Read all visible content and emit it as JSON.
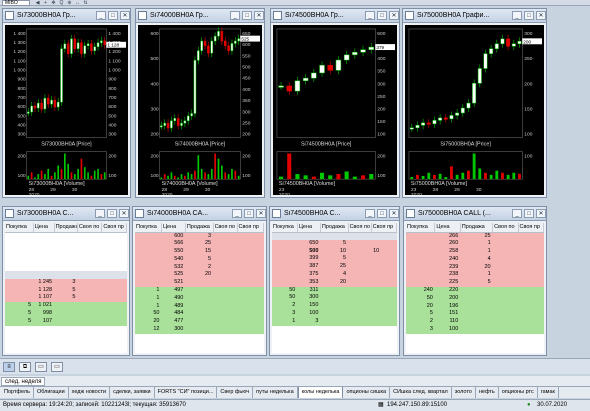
{
  "toolbar": {
    "combo": "MIBO",
    "buttons": [
      "◀",
      "+",
      "✥",
      "Q",
      "⊕",
      "↔",
      "⇅"
    ]
  },
  "charts": [
    {
      "title": "Si73000BH0A Гр...",
      "price_label": "Si73000BH0A [Price]",
      "volume_label": "Si73000BH0A [Volume]",
      "left_ticks": [
        "1 400",
        "1 300",
        "1 200",
        "1 100",
        "1 000",
        "900",
        "800",
        "700",
        "600",
        "500",
        "400",
        "300"
      ],
      "right_ticks": [
        "1 400",
        "1 300",
        "1 200",
        "1 100",
        "1 000",
        "900",
        "800",
        "700",
        "600",
        "500",
        "400",
        "300"
      ],
      "vol_ticks_left": [
        "200",
        "100"
      ],
      "vol_ticks_right": [
        "200",
        "100"
      ],
      "dates": [
        "28",
        "29",
        "30"
      ],
      "year": "2020",
      "marker": "1 128"
    },
    {
      "title": "Si74000BH0A Гр...",
      "price_label": "Si74000BH0A [Price]",
      "volume_label": "Si74000BH0A [Volume]",
      "left_ticks": [
        "600",
        "500",
        "400",
        "300",
        "200"
      ],
      "right_ticks": [
        "650",
        "600",
        "550",
        "500",
        "450",
        "400",
        "350",
        "300",
        "250",
        "200"
      ],
      "vol_ticks_left": [
        "200",
        "100"
      ],
      "vol_ticks_right": [
        "200",
        "100"
      ],
      "dates": [
        "28",
        "29",
        "30"
      ],
      "year": "2020",
      "marker": "525"
    },
    {
      "title": "Si74500BH0A Гр...",
      "price_label": "Si74500BH0A [Price]",
      "volume_label": "Si74500BH0A [Volume]",
      "left_ticks": [],
      "right_ticks": [
        "500",
        "450",
        "400",
        "350",
        "300",
        "250",
        "200",
        "150",
        "100"
      ],
      "vol_ticks_left": [],
      "vol_ticks_right": [
        "200",
        "100"
      ],
      "dates": [
        "23"
      ],
      "year": "2020",
      "marker": "379"
    },
    {
      "title": "Si75000BH0A Графи...",
      "price_label": "Si75000BH0A [Price]",
      "volume_label": "Si75000BH0A [Volume]",
      "left_ticks": [],
      "right_ticks": [
        "300",
        "250",
        "200",
        "150",
        "100"
      ],
      "vol_ticks_left": [],
      "vol_ticks_right": [
        "100"
      ],
      "dates": [
        "23",
        "28",
        "29",
        "30"
      ],
      "year": "2020",
      "marker": "200"
    }
  ],
  "tables": [
    {
      "title": "Si73000BH0A C...",
      "headers": [
        "Покупка",
        "Цена",
        "Продажа",
        "Своя по",
        "Своя пр"
      ],
      "rows": [
        {
          "side": "empty",
          "cells": [
            "",
            "",
            "",
            "",
            ""
          ]
        },
        {
          "side": "empty",
          "cells": [
            "",
            "",
            "",
            "",
            ""
          ]
        },
        {
          "side": "empty",
          "cells": [
            "",
            "",
            "",
            "",
            ""
          ]
        },
        {
          "side": "empty",
          "cells": [
            "",
            "",
            "",
            "",
            ""
          ]
        },
        {
          "side": "empty",
          "cells": [
            "",
            "",
            "",
            "",
            ""
          ]
        },
        {
          "side": "empty",
          "cells": [
            "",
            "",
            "",
            "",
            ""
          ]
        },
        {
          "side": "sell",
          "cells": [
            "",
            "1 245",
            "3",
            "",
            ""
          ]
        },
        {
          "side": "sell",
          "cells": [
            "",
            "1 128",
            "5",
            "",
            ""
          ]
        },
        {
          "side": "sell",
          "cells": [
            "",
            "1 107",
            "5",
            "",
            ""
          ]
        },
        {
          "side": "buy",
          "cells": [
            "5",
            "1 021",
            "",
            "",
            ""
          ]
        },
        {
          "side": "buy",
          "cells": [
            "5",
            "998",
            "",
            "",
            ""
          ]
        },
        {
          "side": "buy",
          "cells": [
            "5",
            "107",
            "",
            "",
            ""
          ]
        }
      ]
    },
    {
      "title": "Si74000BH0A CA...",
      "headers": [
        "Покупка",
        "Цена",
        "Продажа",
        "Своя по",
        "Своя пр"
      ],
      "rows": [
        {
          "side": "sell",
          "cells": [
            "",
            "600",
            "3",
            "",
            ""
          ]
        },
        {
          "side": "sell",
          "cells": [
            "",
            "566",
            "25",
            "",
            ""
          ]
        },
        {
          "side": "sell",
          "cells": [
            "",
            "550",
            "15",
            "",
            ""
          ]
        },
        {
          "side": "sell",
          "cells": [
            "",
            "540",
            "5",
            "",
            ""
          ]
        },
        {
          "side": "sell",
          "cells": [
            "",
            "532",
            "2",
            "",
            ""
          ]
        },
        {
          "side": "sell",
          "cells": [
            "",
            "525",
            "20",
            "",
            ""
          ]
        },
        {
          "side": "sell",
          "cells": [
            "",
            "521",
            "",
            "",
            ""
          ]
        },
        {
          "side": "buy",
          "cells": [
            "1",
            "497",
            "",
            "",
            ""
          ]
        },
        {
          "side": "buy",
          "cells": [
            "1",
            "490",
            "",
            "",
            ""
          ]
        },
        {
          "side": "buy",
          "cells": [
            "1",
            "489",
            "",
            "",
            ""
          ]
        },
        {
          "side": "buy",
          "cells": [
            "50",
            "484",
            "",
            "",
            ""
          ]
        },
        {
          "side": "buy",
          "cells": [
            "20",
            "477",
            "",
            "",
            ""
          ]
        },
        {
          "side": "buy",
          "cells": [
            "12",
            "300",
            "",
            "",
            ""
          ]
        }
      ]
    },
    {
      "title": "Si74500BH0A C...",
      "headers": [
        "Покупка",
        "Цена",
        "Продажа",
        "Своя по",
        "Своя пр"
      ],
      "rows": [
        {
          "side": "empty",
          "cells": [
            "",
            "",
            "",
            "",
            ""
          ]
        },
        {
          "side": "sell",
          "cells": [
            "",
            "650",
            "5",
            "",
            ""
          ]
        },
        {
          "side": "sell",
          "cells": [
            "",
            "500",
            "10",
            "",
            "10"
          ]
        },
        {
          "side": "sell",
          "cells": [
            "",
            "399",
            "5",
            "",
            ""
          ]
        },
        {
          "side": "sell",
          "cells": [
            "",
            "387",
            "25",
            "",
            ""
          ]
        },
        {
          "side": "sell",
          "cells": [
            "",
            "375",
            "4",
            "",
            ""
          ]
        },
        {
          "side": "sell",
          "cells": [
            "",
            "353",
            "20",
            "",
            ""
          ]
        },
        {
          "side": "buy",
          "cells": [
            "50",
            "311",
            "",
            "",
            ""
          ]
        },
        {
          "side": "buy",
          "cells": [
            "50",
            "300",
            "",
            "",
            ""
          ]
        },
        {
          "side": "buy",
          "cells": [
            "2",
            "150",
            "",
            "",
            ""
          ]
        },
        {
          "side": "buy",
          "cells": [
            "3",
            "100",
            "",
            "",
            ""
          ]
        },
        {
          "side": "buy",
          "cells": [
            "1",
            "3",
            "",
            "",
            ""
          ]
        }
      ]
    },
    {
      "title": "Si75000BH0A CALL (...",
      "headers": [
        "Покупка",
        "Цена",
        "Продажа",
        "Своя по",
        "Своя пр"
      ],
      "rows": [
        {
          "side": "sell",
          "cells": [
            "",
            "266",
            "25",
            "",
            ""
          ]
        },
        {
          "side": "sell",
          "cells": [
            "",
            "260",
            "1",
            "",
            ""
          ]
        },
        {
          "side": "sell",
          "cells": [
            "",
            "258",
            "1",
            "",
            ""
          ]
        },
        {
          "side": "sell",
          "cells": [
            "",
            "240",
            "4",
            "",
            ""
          ]
        },
        {
          "side": "sell",
          "cells": [
            "",
            "239",
            "20",
            "",
            ""
          ]
        },
        {
          "side": "sell",
          "cells": [
            "",
            "238",
            "1",
            "",
            ""
          ]
        },
        {
          "side": "sell",
          "cells": [
            "",
            "225",
            "5",
            "",
            ""
          ]
        },
        {
          "side": "buy",
          "cells": [
            "240",
            "220",
            "",
            "",
            ""
          ]
        },
        {
          "side": "buy",
          "cells": [
            "50",
            "200",
            "",
            "",
            ""
          ]
        },
        {
          "side": "buy",
          "cells": [
            "20",
            "196",
            "",
            "",
            ""
          ]
        },
        {
          "side": "buy",
          "cells": [
            "5",
            "151",
            "",
            "",
            ""
          ]
        },
        {
          "side": "buy",
          "cells": [
            "2",
            "110",
            "",
            "",
            ""
          ]
        },
        {
          "side": "buy",
          "cells": [
            "3",
            "100",
            "",
            "",
            ""
          ]
        }
      ]
    }
  ],
  "window_buttons": {
    "min": "_",
    "max": "□",
    "close": "✕"
  },
  "taskbar": {
    "buttons": [
      "≡",
      "⧉",
      "▭",
      "▭"
    ]
  },
  "group_tab": "след. неделя",
  "tabs": [
    "Портфель",
    "Облигации",
    "хедж новости",
    "сделки, заявки",
    "FORTS \"СИ\" позици...",
    "Свер фьюч",
    "путы неделька",
    "колы неделька",
    "опционы сишка",
    "СИшка след. квартал",
    "золото",
    "нефть",
    "опционы ртс",
    "гамак"
  ],
  "active_tab": "колы неделька",
  "status": {
    "server_time": "Время сервера: 19:24:20; записей: 10221243l; текущая: 35913670",
    "ip": "194.247.150.89:15100",
    "date": "30.07.2020"
  },
  "colors": {
    "sell": "#f5b5b5",
    "buy": "#a9e19a",
    "chart_bg": "#000000",
    "candle_up": "#00c800",
    "candle_down": "#e00000"
  },
  "chart_data": [
    {
      "type": "candlestick",
      "series": [
        {
          "name": "Si73000BH0A [Price]",
          "close": [
            560,
            620,
            600,
            650,
            590,
            700,
            640,
            680,
            610,
            660,
            1200,
            1250,
            1150,
            1300,
            1200,
            1260,
            1150,
            1230,
            1250,
            1180,
            1220,
            1260,
            1280,
            1240
          ]
        },
        {
          "name": "Si73000BH0A [Volume]",
          "values": [
            20,
            40,
            10,
            30,
            50,
            30,
            60,
            20,
            40,
            80,
            60,
            150,
            90,
            40,
            30,
            60,
            120,
            70,
            40,
            20,
            50,
            60,
            30,
            40
          ]
        }
      ],
      "ylim": [
        300,
        1400
      ]
    },
    {
      "type": "candlestick",
      "series": [
        {
          "name": "Si74000BH0A [Price]",
          "close": [
            250,
            260,
            240,
            270,
            280,
            250,
            260,
            270,
            290,
            300,
            520,
            560,
            600,
            580,
            550,
            600,
            620,
            640,
            600,
            580,
            560,
            590,
            600,
            610
          ]
        },
        {
          "name": "Si74000BH0A [Volume]",
          "values": [
            10,
            30,
            20,
            40,
            20,
            10,
            30,
            20,
            40,
            30,
            50,
            140,
            60,
            40,
            30,
            60,
            150,
            120,
            80,
            40,
            30,
            60,
            50,
            20
          ]
        }
      ],
      "ylim": [
        200,
        650
      ]
    },
    {
      "type": "candlestick",
      "series": [
        {
          "name": "Si74500BH0A [Price]",
          "close": [
            300,
            280,
            320,
            330,
            350,
            380,
            360,
            400,
            420,
            430,
            440,
            450
          ]
        },
        {
          "name": "Si74500BH0A [Volume]",
          "values": [
            20,
            200,
            40,
            30,
            20,
            50,
            30,
            40,
            60,
            20,
            30,
            40
          ]
        }
      ],
      "ylim": [
        100,
        520
      ]
    },
    {
      "type": "candlestick",
      "series": [
        {
          "name": "Si75000BH0A [Price]",
          "close": [
            110,
            115,
            120,
            118,
            125,
            130,
            128,
            135,
            140,
            150,
            160,
            200,
            230,
            260,
            270,
            280,
            290,
            275,
            280,
            285
          ]
        },
        {
          "name": "Si75000BH0A [Volume]",
          "values": [
            10,
            20,
            15,
            30,
            20,
            25,
            10,
            60,
            20,
            30,
            40,
            120,
            50,
            30,
            20,
            40,
            30,
            20,
            30,
            25
          ]
        }
      ],
      "ylim": [
        90,
        310
      ]
    }
  ]
}
